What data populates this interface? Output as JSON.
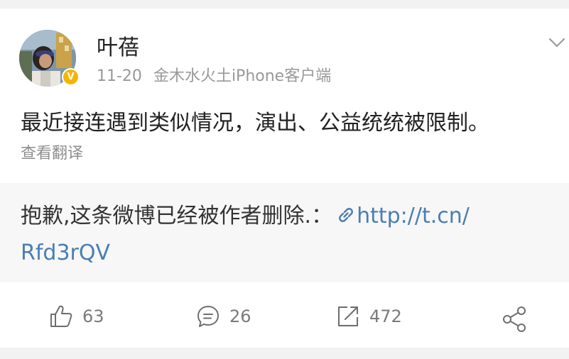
{
  "post": {
    "username": "叶蓓",
    "date": "11-20",
    "source": "金木水火土iPhone客户端",
    "verified_badge": "V",
    "text": "最近接连遇到类似情况，演出、公益统统被限制。",
    "translate_label": "查看翻译"
  },
  "repost": {
    "notice": "抱歉,这条微博已经被作者删除.：",
    "link_part1": "http://t.cn/",
    "link_part2": "Rfd3rQV"
  },
  "actions": {
    "likes": "63",
    "comments": "26",
    "reposts": "472"
  },
  "icons": {
    "menu": "chevron-down-icon",
    "link": "link-icon",
    "like": "thumbs-up-icon",
    "comment": "comment-icon",
    "repost": "repost-icon",
    "share": "share-icon"
  },
  "colors": {
    "link": "#4a7eb3",
    "badge": "#f5b400",
    "text": "#222222",
    "meta": "#999999"
  }
}
